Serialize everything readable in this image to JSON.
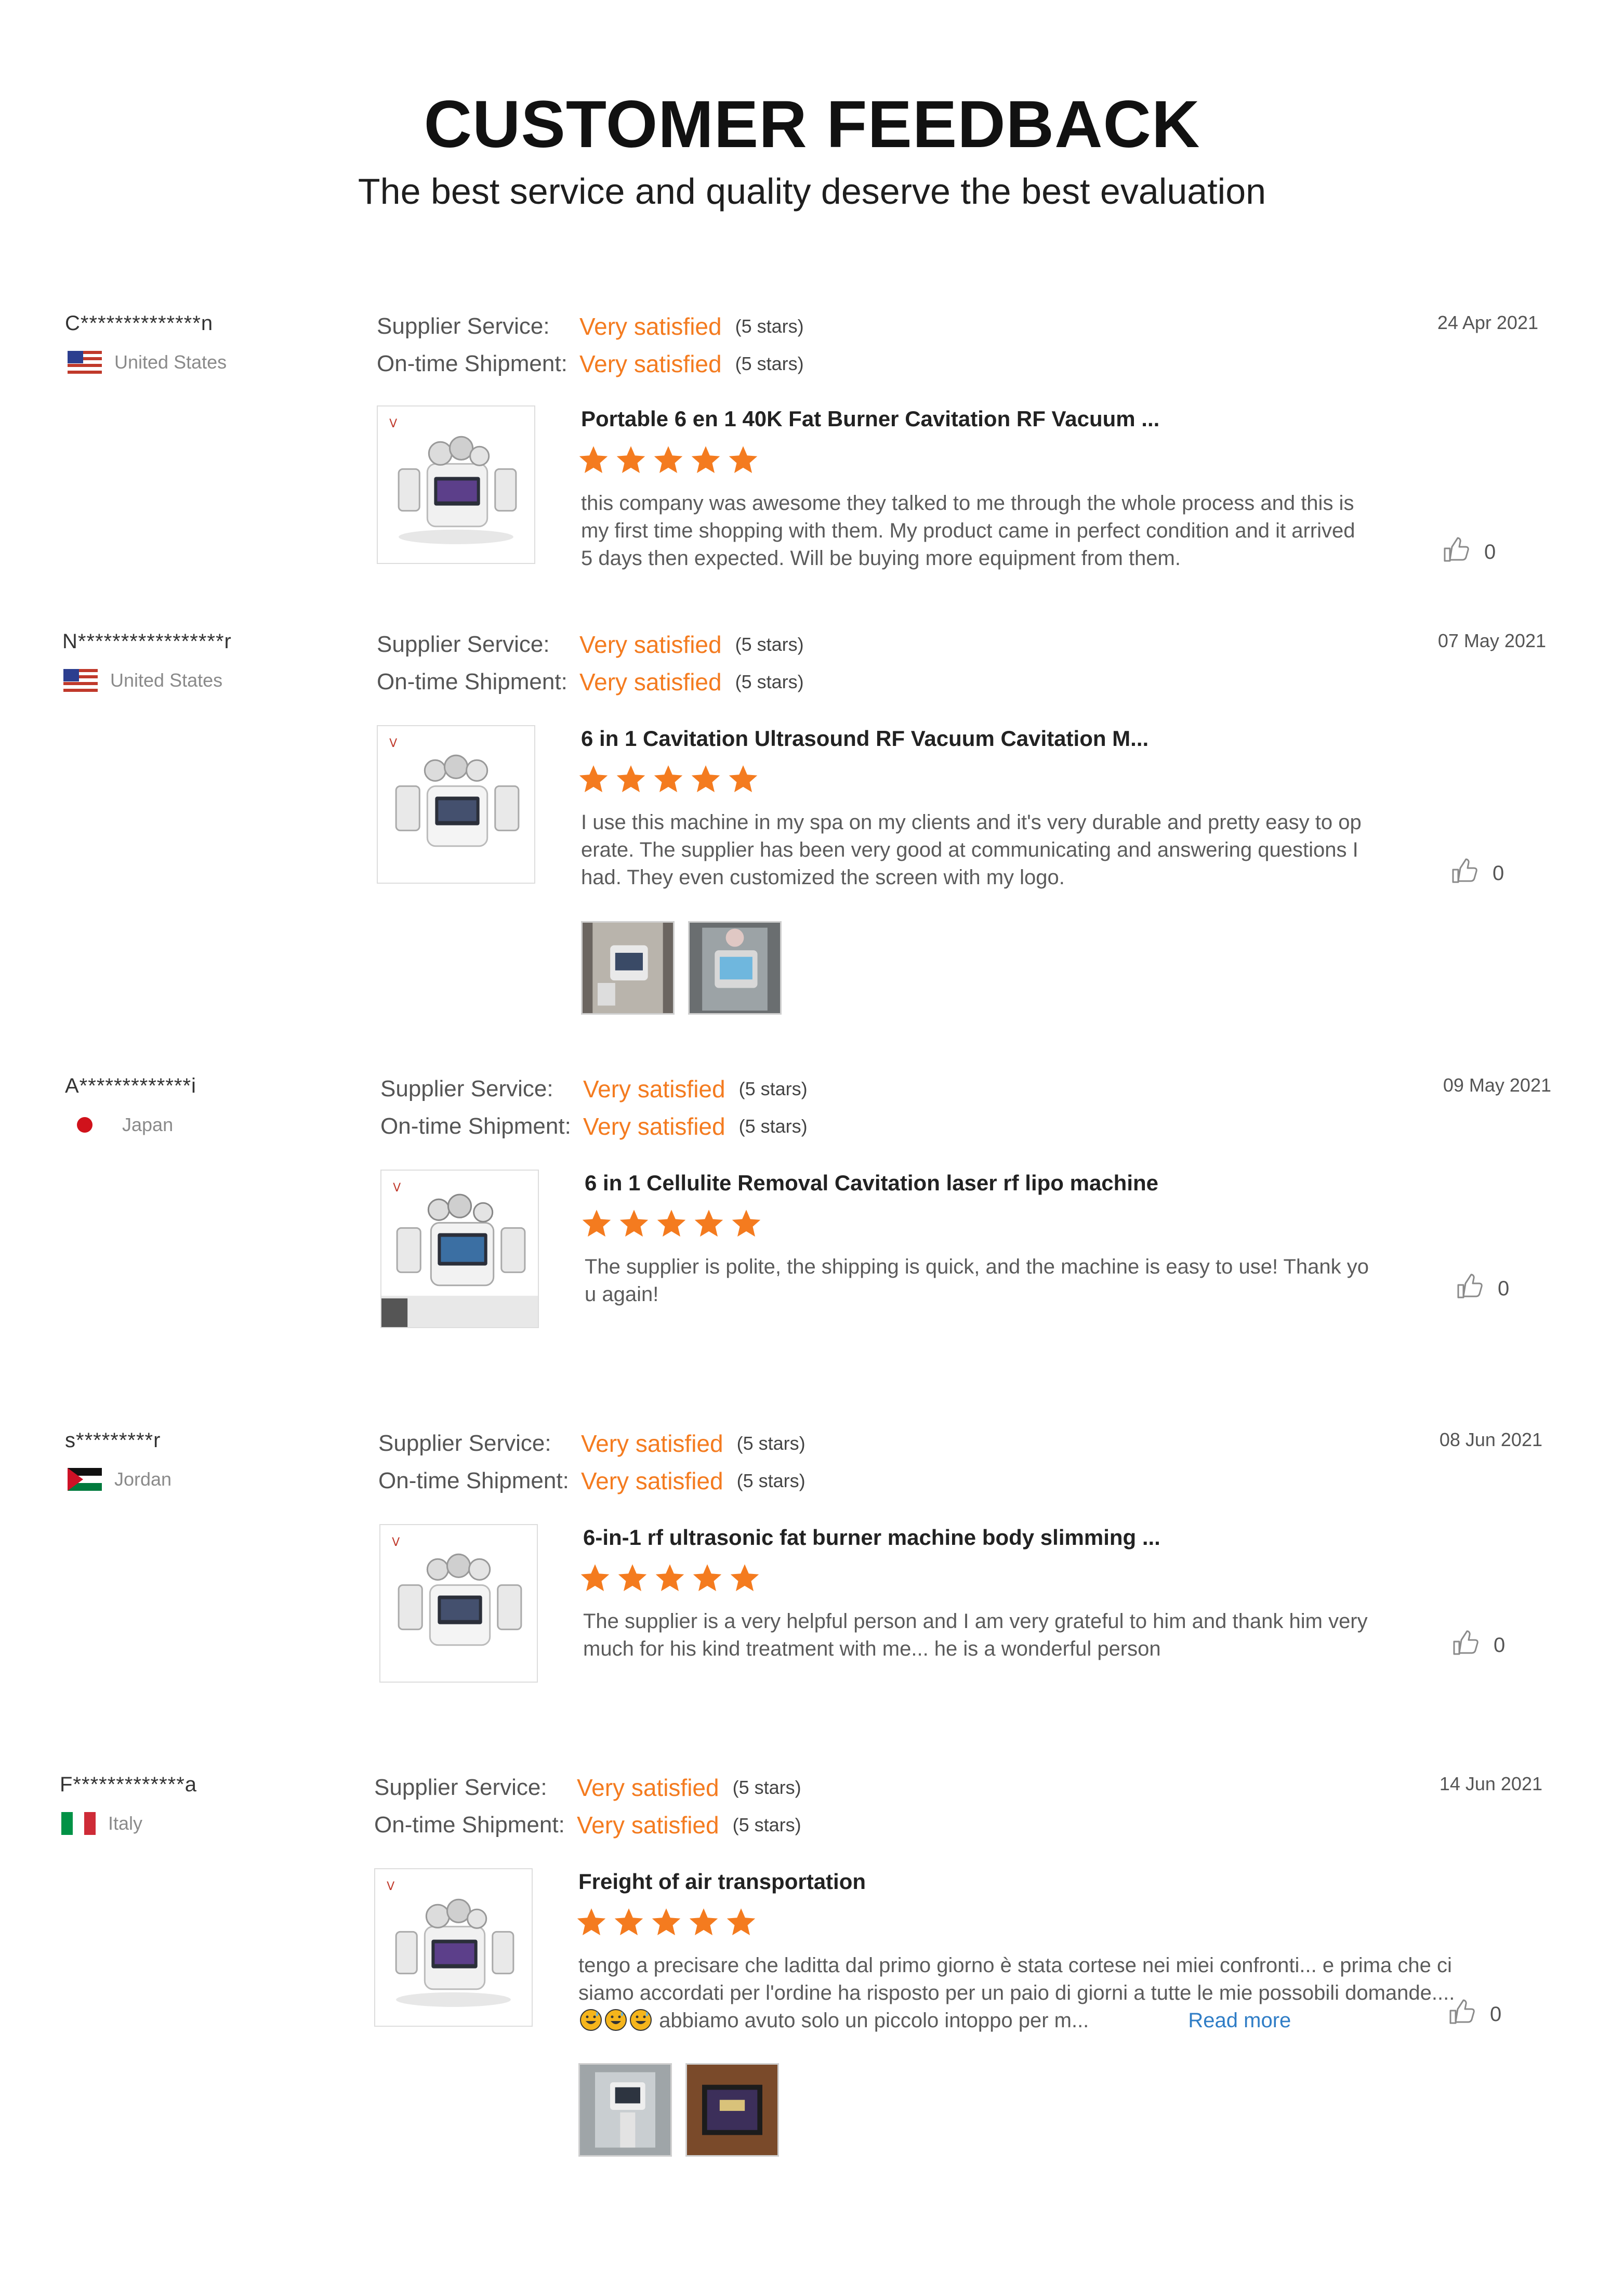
{
  "header": {
    "title": "CUSTOMER FEEDBACK",
    "subtitle": "The best service and quality deserve the best evaluation"
  },
  "reviews": [
    {
      "user": "C**************n",
      "country": "United States",
      "flag_icon": "us-flag-icon",
      "date": "24 Apr 2021",
      "supplier_service_label": "Supplier Service:",
      "supplier_service_value": "Very satisfied",
      "supplier_service_stars": "(5 stars)",
      "shipment_label": "On-time Shipment:",
      "shipment_value": "Very satisfied",
      "shipment_stars": "(5 stars)",
      "product_title": "Portable 6 en 1 40K Fat Burner Cavitation RF Vacuum ...",
      "rating": 5,
      "text": "this company was awesome they talked to me through the whole process and this is my first time shopping with them. My product came in perfect condition and it arrived 5 days then expected. Will be buying more equipment from them.",
      "likes": "0"
    },
    {
      "user": "N*****************r",
      "country": "United States",
      "flag_icon": "us-flag-icon",
      "date": "07 May 2021",
      "supplier_service_label": "Supplier Service:",
      "supplier_service_value": "Very satisfied",
      "supplier_service_stars": "(5 stars)",
      "shipment_label": "On-time Shipment:",
      "shipment_value": "Very satisfied",
      "shipment_stars": "(5 stars)",
      "product_title": "6 in 1 Cavitation Ultrasound RF Vacuum Cavitation M...",
      "rating": 5,
      "text": "I use this machine in my spa on my clients and it's very durable and pretty easy to operate. The supplier has been very good at communicating and answering questions I had. They even customized the screen with my logo.",
      "likes": "0"
    },
    {
      "user": "A*************i",
      "country": "Japan",
      "flag_icon": "japan-flag-icon",
      "date": "09 May 2021",
      "supplier_service_label": "Supplier Service:",
      "supplier_service_value": "Very satisfied",
      "supplier_service_stars": "(5 stars)",
      "shipment_label": "On-time Shipment:",
      "shipment_value": "Very satisfied",
      "shipment_stars": "(5 stars)",
      "product_title": "6 in 1 Cellulite Removal Cavitation laser rf lipo machine",
      "rating": 5,
      "text": "The supplier is polite, the shipping is quick, and the machine is easy to use! Thank you again!",
      "likes": "0"
    },
    {
      "user": "s*********r",
      "country": "Jordan",
      "flag_icon": "jordan-flag-icon",
      "date": "08 Jun 2021",
      "supplier_service_label": "Supplier Service:",
      "supplier_service_value": "Very satisfied",
      "supplier_service_stars": "(5 stars)",
      "shipment_label": "On-time Shipment:",
      "shipment_value": "Very satisfied",
      "shipment_stars": "(5 stars)",
      "product_title": "6-in-1 rf ultrasonic fat burner machine body slimming ...",
      "rating": 5,
      "text": "The supplier is a very helpful person and I am very grateful to him and thank him very much for his kind treatment with me... he is a wonderful person",
      "likes": "0"
    },
    {
      "user": "F*************a",
      "country": "Italy",
      "flag_icon": "italy-flag-icon",
      "date": "14 Jun 2021",
      "supplier_service_label": "Supplier Service:",
      "supplier_service_value": "Very satisfied",
      "supplier_service_stars": "(5 stars)",
      "shipment_label": "On-time Shipment:",
      "shipment_value": "Very satisfied",
      "shipment_stars": "(5 stars)",
      "product_title": "Freight of air transportation",
      "rating": 5,
      "text_before_emoji": "tengo a precisare che laditta dal primo giorno è stata cortese nei miei confronti... e prima che ci siamo accordati per l'ordine ha risposto per un paio di giorni a tutte le mie possobili domande....",
      "text_after_emoji": "abbiamo avuto solo  un piccolo  intoppo per m...",
      "read_more": "Read more",
      "likes": "0"
    }
  ]
}
